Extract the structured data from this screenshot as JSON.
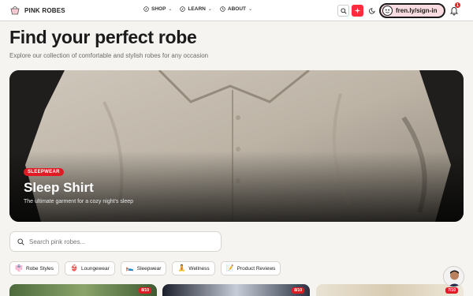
{
  "nav": {
    "brand": "PINK ROBES",
    "menu": [
      {
        "label": "SHOP",
        "icon": "compass-icon"
      },
      {
        "label": "LEARN",
        "icon": "compass-icon"
      },
      {
        "label": "ABOUT",
        "icon": "clock-icon"
      }
    ],
    "fren_label": "fren.ly/sign-in",
    "notification_count": "1"
  },
  "header": {
    "title": "Find your perfect robe",
    "subtitle": "Explore our collection of comfortable and stylish robes for any occasion"
  },
  "hero": {
    "badge": "SLEEPWEAR",
    "title": "Sleep Shirt",
    "description": "The ultimate garment for a cozy night's sleep"
  },
  "search": {
    "placeholder": "Search pink robes..."
  },
  "categories": [
    {
      "label": "Robe Styles",
      "emoji": "👘"
    },
    {
      "label": "Loungewear",
      "emoji": "👙"
    },
    {
      "label": "Sleepwear",
      "emoji": "🛌"
    },
    {
      "label": "Wellness",
      "emoji": "🧘"
    },
    {
      "label": "Product Reviews",
      "emoji": "📝"
    }
  ],
  "cards": [
    {
      "score": "8/10"
    },
    {
      "score": "8/10"
    },
    {
      "score": "7/10"
    }
  ],
  "colors": {
    "accent": "#e21a24",
    "pill_bg": "#f9dce1",
    "page_bg": "#f6f4f1"
  }
}
